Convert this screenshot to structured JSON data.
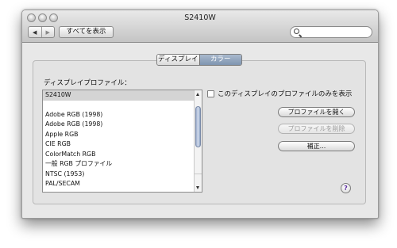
{
  "window": {
    "title": "S2410W"
  },
  "toolbar": {
    "back_glyph": "◀",
    "forward_glyph": "▶",
    "show_all_label": "すべてを表示",
    "search_placeholder": ""
  },
  "tabs": [
    {
      "label": "ディスプレイ",
      "selected": false
    },
    {
      "label": "カラー",
      "selected": true
    }
  ],
  "color": {
    "list_label": "ディスプレイプロファイル：",
    "profiles": [
      {
        "label": "S2410W",
        "selected": true
      },
      {
        "label": "",
        "selected": false
      },
      {
        "label": "Adobe RGB (1998)",
        "selected": false
      },
      {
        "label": "Adobe RGB (1998)",
        "selected": false
      },
      {
        "label": "Apple RGB",
        "selected": false
      },
      {
        "label": "CIE RGB",
        "selected": false
      },
      {
        "label": "ColorMatch RGB",
        "selected": false
      },
      {
        "label": "一般 RGB プロファイル",
        "selected": false
      },
      {
        "label": "NTSC (1953)",
        "selected": false
      },
      {
        "label": "PAL/SECAM",
        "selected": false
      }
    ],
    "only_this_display_label": "このディスプレイのプロファイルのみを表示",
    "open_profile_label": "プロファイルを開く",
    "delete_profile_label": "プロファイルを削除",
    "calibrate_label": "補正...",
    "help_glyph": "?"
  },
  "colors": {
    "selected_tab": "#8b9fb9",
    "help_icon": "#5a2aa0"
  }
}
